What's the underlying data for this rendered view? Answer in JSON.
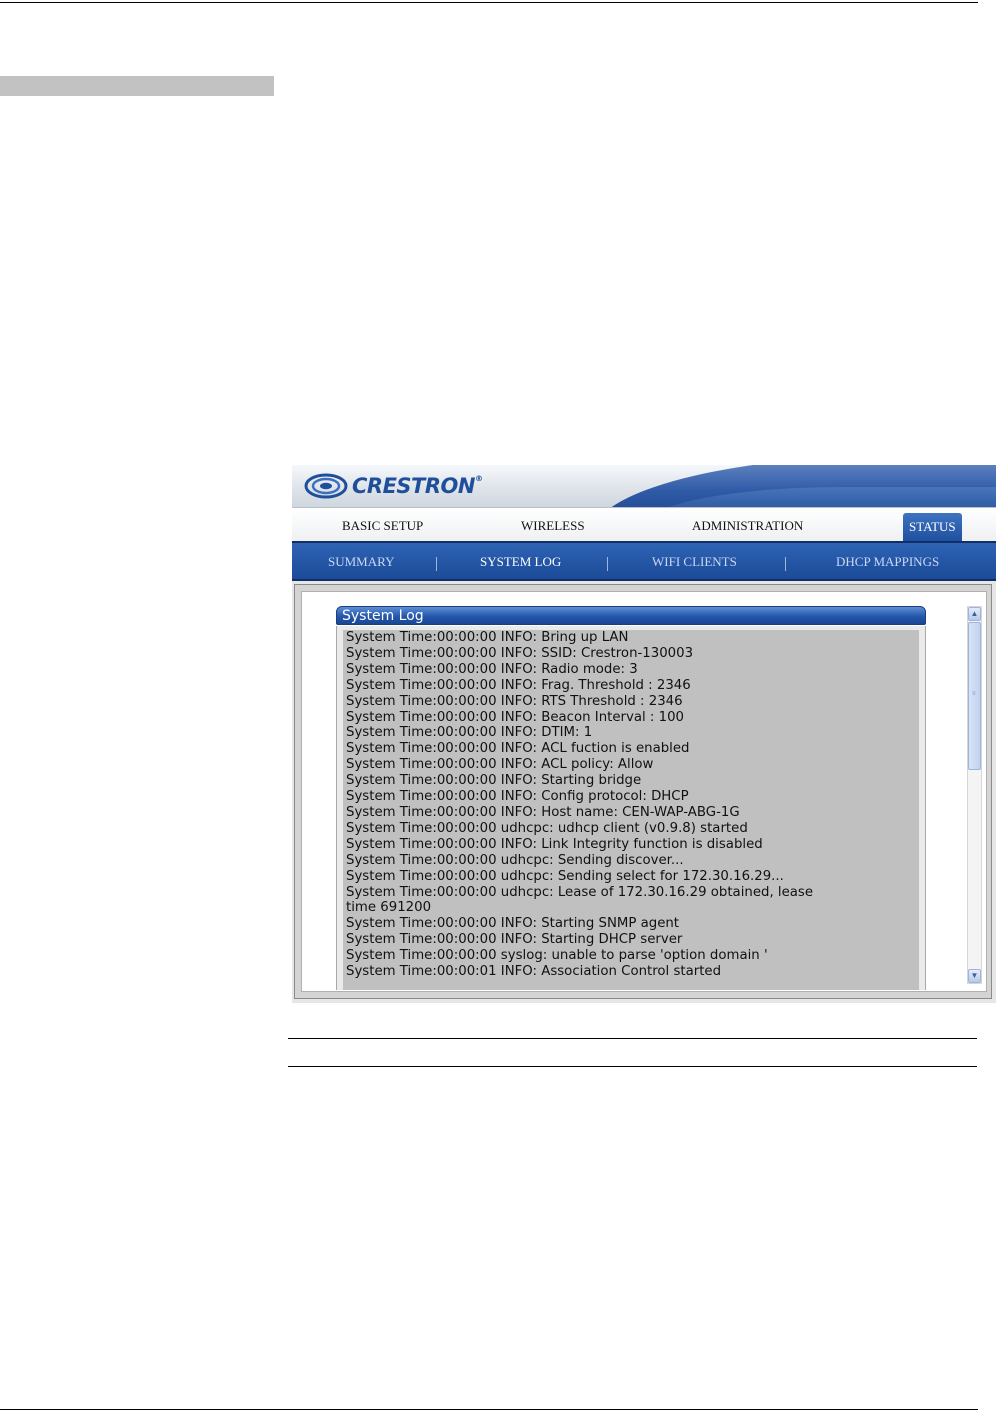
{
  "header": {
    "brand": "CRESTRON",
    "brand_mark": "®"
  },
  "nav": {
    "items": [
      {
        "label": "BASIC SETUP"
      },
      {
        "label": "WIRELESS"
      },
      {
        "label": "ADMINISTRATION"
      },
      {
        "label": "STATUS",
        "active": true
      }
    ]
  },
  "subnav": {
    "items": [
      {
        "label": "SUMMARY"
      },
      {
        "label": "SYSTEM LOG",
        "active": true
      },
      {
        "label": "WIFI CLIENTS"
      },
      {
        "label": "DHCP MAPPINGS"
      }
    ]
  },
  "system_log": {
    "title": "System Log",
    "lines": [
      "System Time:00:00:00 INFO: Bring up LAN",
      "System Time:00:00:00 INFO: SSID: Crestron-130003",
      "System Time:00:00:00 INFO: Radio mode: 3",
      "System Time:00:00:00 INFO: Frag. Threshold : 2346",
      "System Time:00:00:00 INFO: RTS Threshold : 2346",
      "System Time:00:00:00 INFO: Beacon Interval : 100",
      "System Time:00:00:00 INFO: DTIM: 1",
      "System Time:00:00:00 INFO: ACL fuction is enabled",
      "System Time:00:00:00 INFO: ACL policy: Allow",
      "System Time:00:00:00 INFO: Starting bridge",
      "System Time:00:00:00 INFO: Config protocol: DHCP",
      "System Time:00:00:00 INFO: Host name: CEN-WAP-ABG-1G",
      "System Time:00:00:00 udhcpc: udhcp client (v0.9.8) started",
      "System Time:00:00:00 INFO: Link Integrity function is disabled",
      "System Time:00:00:00 udhcpc: Sending discover...",
      "System Time:00:00:00 udhcpc: Sending select for 172.30.16.29...",
      "System Time:00:00:00 udhcpc: Lease of 172.30.16.29 obtained, lease",
      "time 691200",
      "System Time:00:00:00 INFO: Starting SNMP agent",
      "System Time:00:00:00 INFO: Starting DHCP server",
      "System Time:00:00:00 syslog: unable to parse 'option domain '",
      "System Time:00:00:01 INFO: Association Control started"
    ]
  },
  "colors": {
    "brand_blue": "#1f4f9a",
    "nav_blue": "#1b4b98",
    "log_bg": "#c0c0c0"
  },
  "icons": {
    "scroll_up": "scroll-up-icon",
    "scroll_down": "scroll-down-icon"
  }
}
